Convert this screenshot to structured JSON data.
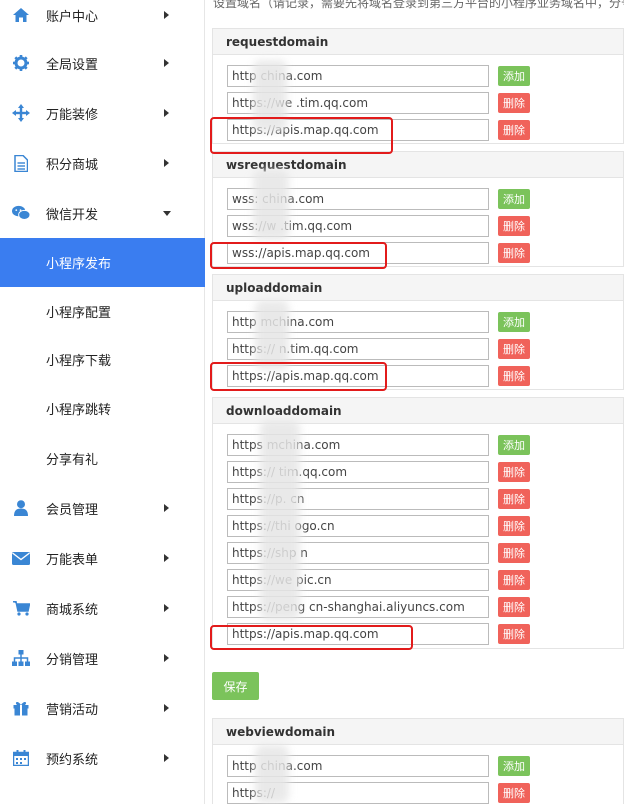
{
  "sidebar": {
    "items": [
      {
        "label": "账户中心",
        "icon": "home-icon"
      },
      {
        "label": "全局设置",
        "icon": "gear-icon"
      },
      {
        "label": "万能装修",
        "icon": "move-arrows-icon"
      },
      {
        "label": "积分商城",
        "icon": "document-icon"
      },
      {
        "label": "微信开发",
        "icon": "wechat-icon"
      },
      {
        "label": "会员管理",
        "icon": "user-icon"
      },
      {
        "label": "万能表单",
        "icon": "envelope-icon"
      },
      {
        "label": "商城系统",
        "icon": "cart-icon"
      },
      {
        "label": "分销管理",
        "icon": "sitemap-icon"
      },
      {
        "label": "营销活动",
        "icon": "gift-icon"
      },
      {
        "label": "预约系统",
        "icon": "calendar-icon"
      }
    ],
    "sub_items": [
      {
        "label": "小程序发布",
        "active": true
      },
      {
        "label": "小程序配置",
        "active": false
      },
      {
        "label": "小程序下载",
        "active": false
      },
      {
        "label": "小程序跳转",
        "active": false
      },
      {
        "label": "分享有礼",
        "active": false
      }
    ]
  },
  "main": {
    "top_note": "设置域名（请记录，需要先将域名登录到第三方平台的小程序业务域名中，分号",
    "buttons": {
      "add": "添加",
      "delete": "删除",
      "save": "保存"
    },
    "sections": [
      {
        "title": "requestdomain",
        "rows": [
          "http            china.com",
          "https://we      .tim.qq.com",
          "https://apis.map.qq.com"
        ]
      },
      {
        "title": "wsrequestdomain",
        "rows": [
          "wss:           china.com",
          "wss://w         .tim.qq.com",
          "wss://apis.map.qq.com"
        ]
      },
      {
        "title": "uploaddomain",
        "rows": [
          "http           mchina.com",
          "https://        n.tim.qq.com",
          "https://apis.map.qq.com"
        ]
      },
      {
        "title": "downloaddomain",
        "rows": [
          "https          mchina.com",
          "https://        tim.qq.com",
          "https://p.      cn",
          "https://thi      ogo.cn",
          "https://shp      n",
          "https://we      pic.cn",
          "https://peng      cn-shanghai.aliyuncs.com",
          "https://apis.map.qq.com"
        ]
      },
      {
        "title": "webviewdomain",
        "rows": [
          "http           china.com",
          "https://"
        ]
      }
    ]
  }
}
